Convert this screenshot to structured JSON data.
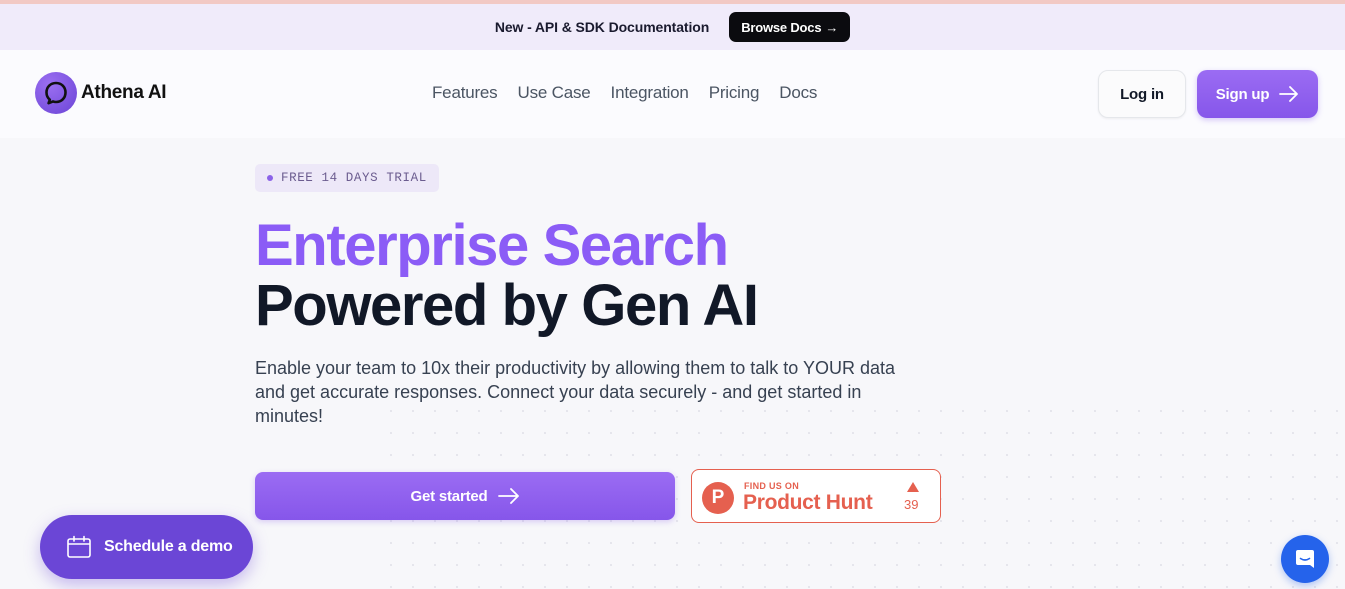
{
  "banner": {
    "text": "New - API & SDK Documentation",
    "button_label": "Browse Docs",
    "button_arrow": "→"
  },
  "nav": {
    "logo_text": "Athena AI",
    "links": [
      "Features",
      "Use Case",
      "Integration",
      "Pricing",
      "Docs"
    ],
    "login_label": "Log in",
    "signup_label": "Sign up"
  },
  "hero": {
    "badge": "FREE 14 DAYS TRIAL",
    "title_line1": "Enterprise Search",
    "title_line2": "Powered by Gen AI",
    "description": "Enable your team to 10x their productivity by allowing them to talk to YOUR data and get accurate responses. Connect your data securely - and get started in minutes!",
    "cta_label": "Get started"
  },
  "product_hunt": {
    "logo_letter": "P",
    "small_text": "FIND US ON",
    "big_text": "Product Hunt",
    "upvotes": "39"
  },
  "floating": {
    "demo_label": "Schedule a demo"
  },
  "colors": {
    "brand_purple": "#8b5cf6",
    "demo_purple": "#6b46d6",
    "product_hunt": "#e5604f",
    "chat_blue": "#2563eb"
  },
  "icons": [
    "speech-bubble-logo-icon",
    "arrow-right-icon",
    "calendar-icon",
    "chat-icon",
    "upvote-triangle-icon"
  ]
}
